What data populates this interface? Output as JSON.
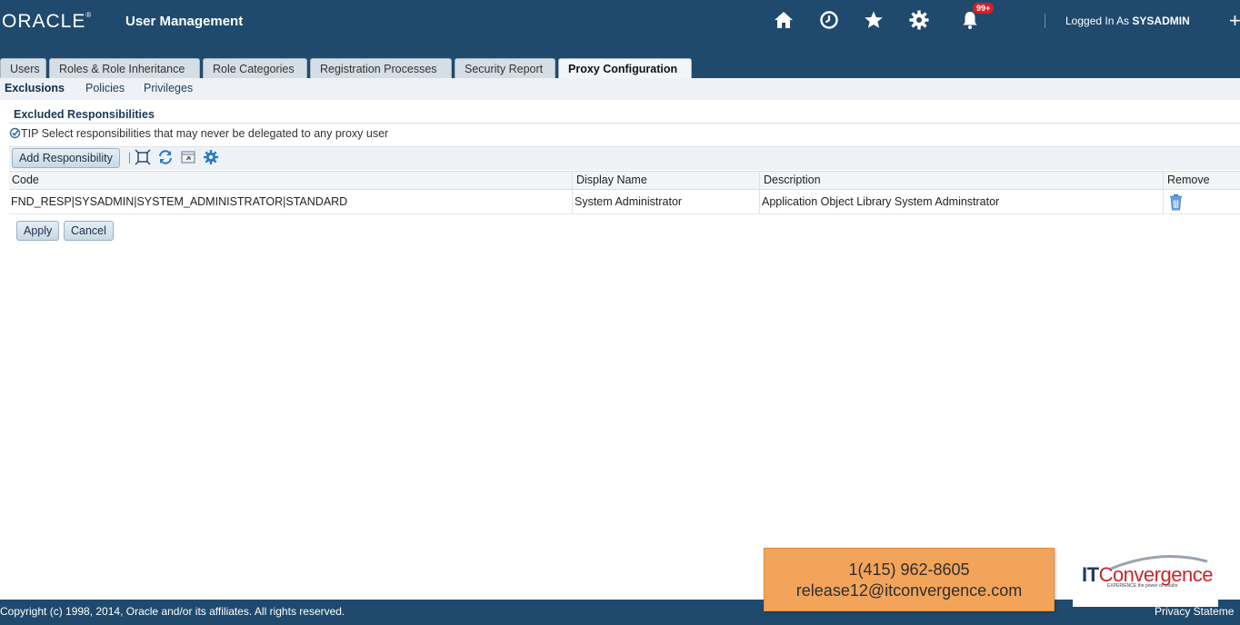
{
  "header": {
    "logo": "ORACLE",
    "app_title": "User Management",
    "notifications_badge": "99+",
    "logged_in_prefix": "Logged In As",
    "logged_in_user": "SYSADMIN",
    "icons": [
      "home-icon",
      "recent-clock-icon",
      "favorites-star-icon",
      "settings-gear-icon",
      "notifications-bell-icon"
    ]
  },
  "tabs": [
    {
      "label": "Users"
    },
    {
      "label": "Roles & Role Inheritance"
    },
    {
      "label": "Role Categories"
    },
    {
      "label": "Registration Processes"
    },
    {
      "label": "Security Report"
    },
    {
      "label": "Proxy Configuration",
      "active": true
    }
  ],
  "subnav": {
    "items": [
      "Exclusions",
      "Policies",
      "Privileges"
    ],
    "selected": "Exclusions"
  },
  "section": {
    "title": "Excluded Responsibilities",
    "tip_label": "TIP",
    "tip_text": "Select responsibilities that may never be delegated to any proxy user"
  },
  "toolbar": {
    "add_label": "Add Responsibility",
    "icons": [
      "detach-icon",
      "refresh-icon",
      "export-icon",
      "personalize-gear-icon"
    ]
  },
  "table": {
    "columns": [
      "Code",
      "Display Name",
      "Description",
      "Remove"
    ],
    "rows": [
      {
        "code": "FND_RESP|SYSADMIN|SYSTEM_ADMINISTRATOR|STANDARD",
        "display_name": "System Administrator",
        "description": "Application Object Library System Adminstrator"
      }
    ]
  },
  "actions": {
    "apply": "Apply",
    "cancel": "Cancel"
  },
  "footer": {
    "copyright": "Copyright (c) 1998, 2014, Oracle and/or its affiliates. All rights reserved.",
    "privacy": "Privacy Stateme"
  },
  "promo": {
    "phone": "1(415) 962-8605",
    "email": "release12@itconvergence.com",
    "brand_it": "IT",
    "brand_name": "Convergence",
    "brand_tagline": "EXPERIENCE the power of results"
  },
  "colors": {
    "header_bg": "#1f4a6e",
    "promo_bg": "#f2a45a",
    "brand_red": "#c8262b"
  }
}
